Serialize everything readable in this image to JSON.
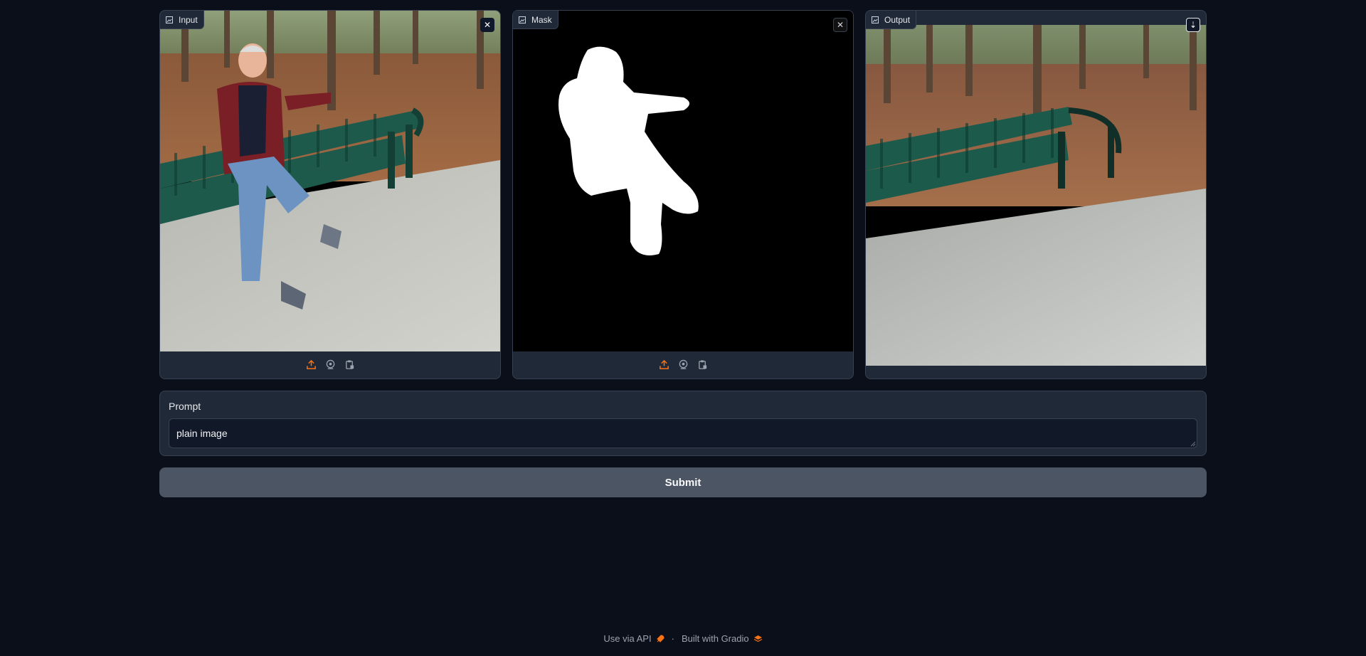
{
  "panels": {
    "input": {
      "label": "Input",
      "close_icon": "close-icon",
      "tools": [
        "upload-icon",
        "webcam-icon",
        "clipboard-icon"
      ]
    },
    "mask": {
      "label": "Mask",
      "close_icon": "close-icon",
      "tools": [
        "upload-icon",
        "webcam-icon",
        "clipboard-icon"
      ]
    },
    "output": {
      "label": "Output",
      "download_icon": "download-icon"
    }
  },
  "prompt": {
    "label": "Prompt",
    "value": "plain image"
  },
  "submit": {
    "label": "Submit"
  },
  "footer": {
    "api_label": "Use via API",
    "separator": "·",
    "built_label": "Built with Gradio"
  },
  "colors": {
    "accent": "#f97316",
    "background": "#0b0f19",
    "panel": "#1f2937",
    "button": "#4b5563"
  }
}
